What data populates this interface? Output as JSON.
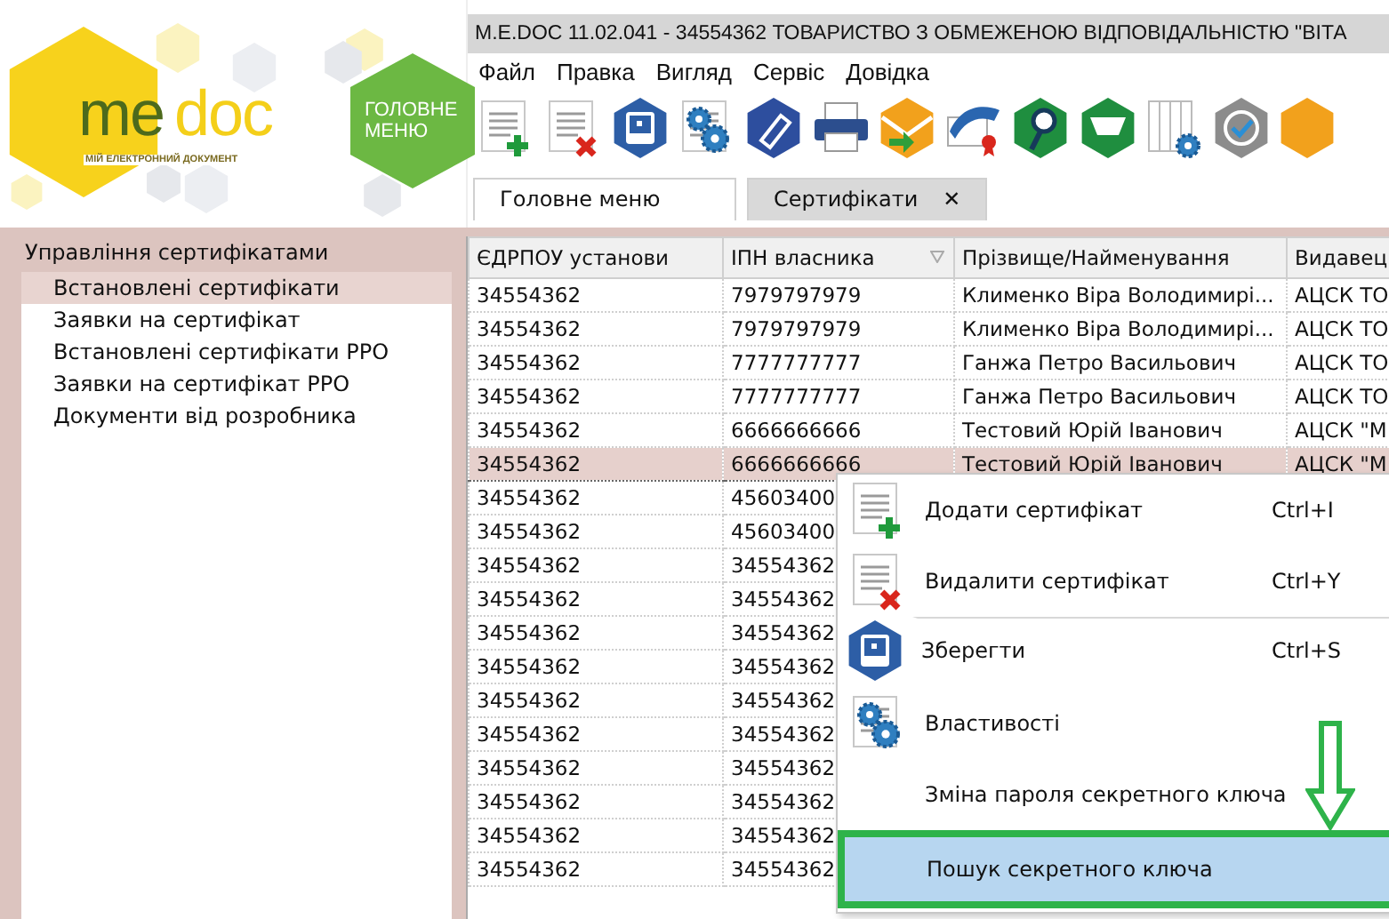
{
  "logo": {
    "brand_me": "me",
    "brand_doc": "doc",
    "tagline": "МІЙ ЕЛЕКТРОННИЙ ДОКУМЕНТ"
  },
  "main_menu_button": {
    "label": "ГОЛОВНЕ МЕНЮ"
  },
  "window": {
    "title": "M.E.DOC 11.02.041  - 34554362 ТОВАРИСТВО З ОБМЕЖЕНОЮ ВІДПОВІДАЛЬНІСТЮ \"ВІТА"
  },
  "menu_bar": [
    "Файл",
    "Правка",
    "Вигляд",
    "Сервіс",
    "Довідка"
  ],
  "tabs": [
    {
      "label": "Головне меню",
      "selected": false
    },
    {
      "label": "Сертифікати",
      "selected": true,
      "close": "✕"
    }
  ],
  "sidebar": {
    "title": "Управління сертифікатами",
    "items": [
      {
        "label": "Встановлені сертифікати",
        "selected": true
      },
      {
        "label": "Заявки на сертифікат",
        "selected": false
      },
      {
        "label": "Встановлені сертифікати РРО",
        "selected": false
      },
      {
        "label": "Заявки на сертифікат РРО",
        "selected": false
      },
      {
        "label": "Документи від розробника",
        "selected": false
      }
    ]
  },
  "table": {
    "columns": [
      "ЄДРПОУ установи",
      "ІПН власника",
      "Прізвище/Найменування",
      "Видавец"
    ],
    "rows": [
      {
        "cells": [
          "34554362",
          "7979797979",
          "Клименко Віра Володимирі...",
          "АЦСК ТО"
        ],
        "selected": false
      },
      {
        "cells": [
          "34554362",
          "7979797979",
          "Клименко Віра Володимирі...",
          "АЦСК ТО"
        ],
        "selected": false
      },
      {
        "cells": [
          "34554362",
          "7777777777",
          "Ганжа Петро Васильович",
          "АЦСК ТО"
        ],
        "selected": false
      },
      {
        "cells": [
          "34554362",
          "7777777777",
          "Ганжа Петро Васильович",
          "АЦСК ТО"
        ],
        "selected": false
      },
      {
        "cells": [
          "34554362",
          "6666666666",
          "Тестовий Юрій Іванович",
          "АЦСК \"М"
        ],
        "selected": false
      },
      {
        "cells": [
          "34554362",
          "6666666666",
          "Тестовий Юрій Іванович",
          "АЦСК \"М"
        ],
        "selected": true
      },
      {
        "cells": [
          "34554362",
          "45603400"
        ],
        "selected": false
      },
      {
        "cells": [
          "34554362",
          "45603400"
        ],
        "selected": false
      },
      {
        "cells": [
          "34554362",
          "34554362"
        ],
        "selected": false
      },
      {
        "cells": [
          "34554362",
          "34554362"
        ],
        "selected": false
      },
      {
        "cells": [
          "34554362",
          "34554362"
        ],
        "selected": false
      },
      {
        "cells": [
          "34554362",
          "34554362"
        ],
        "selected": false
      },
      {
        "cells": [
          "34554362",
          "34554362"
        ],
        "selected": false
      },
      {
        "cells": [
          "34554362",
          "34554362"
        ],
        "selected": false
      },
      {
        "cells": [
          "34554362",
          "34554362"
        ],
        "selected": false
      },
      {
        "cells": [
          "34554362",
          "34554362"
        ],
        "selected": false
      },
      {
        "cells": [
          "34554362",
          "34554362"
        ],
        "selected": false
      },
      {
        "cells": [
          "34554362",
          "34554362"
        ],
        "selected": false
      }
    ]
  },
  "context_menu": {
    "items": [
      {
        "label": "Додати сертифікат",
        "shortcut": "Ctrl+I",
        "selected": false,
        "divider_above": false
      },
      {
        "label": "Видалити сертифікат",
        "shortcut": "Ctrl+Y",
        "selected": false,
        "divider_above": false
      },
      {
        "label": "Зберегти",
        "shortcut": "Ctrl+S",
        "selected": false,
        "divider_above": true
      },
      {
        "label": "Властивості",
        "selected": false,
        "divider_above": false
      },
      {
        "label": "Зміна пароля секретного ключа",
        "selected": false,
        "divider_above": false
      },
      {
        "label": "Пошук секретного ключа",
        "selected": true,
        "divider_above": false
      }
    ]
  }
}
